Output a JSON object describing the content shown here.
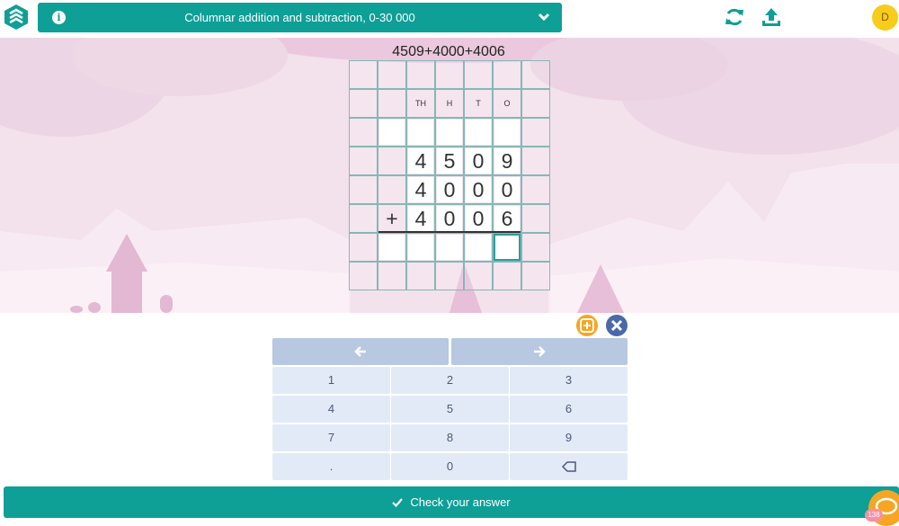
{
  "header": {
    "title": "Columnar addition and subtraction, 0-30 000",
    "info_icon_glyph": "i",
    "user_initial": "D"
  },
  "exercise": {
    "equation": "4509+4000+4006",
    "column_headers": [
      "TH",
      "H",
      "T",
      "O"
    ],
    "rows": [
      {
        "operator": "",
        "digits": [
          "4",
          "5",
          "0",
          "9"
        ]
      },
      {
        "operator": "",
        "digits": [
          "4",
          "0",
          "0",
          "0"
        ]
      },
      {
        "operator": "+",
        "digits": [
          "4",
          "0",
          "0",
          "6"
        ]
      }
    ]
  },
  "keypad": {
    "keys": [
      [
        "1",
        "2",
        "3"
      ],
      [
        "4",
        "5",
        "6"
      ],
      [
        "7",
        "8",
        "9"
      ],
      [
        ".",
        "0",
        "backspace"
      ]
    ]
  },
  "footer": {
    "check_label": "Check your answer",
    "notification_count": "138"
  },
  "colors": {
    "primary": "#0e9f96",
    "avatar": "#f8cc1a",
    "add_button": "#f6a623",
    "close_button": "#4a69a8",
    "key_bg": "#e3eaf7",
    "arrow_key_bg": "#b7c8e0"
  },
  "icons": [
    "logo-icon",
    "info-icon",
    "chevron-down-icon",
    "refresh-icon",
    "upload-icon",
    "add-icon",
    "close-icon",
    "arrow-left-icon",
    "arrow-right-icon",
    "backspace-icon",
    "check-icon",
    "chat-icon"
  ]
}
